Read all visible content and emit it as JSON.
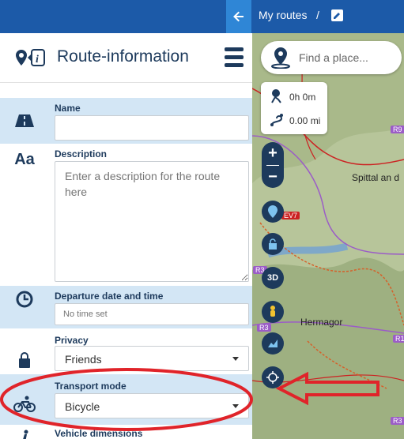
{
  "topbar": {
    "breadcrumb": "My routes",
    "separator": "/"
  },
  "panel": {
    "title": "Route-information",
    "name": {
      "label": "Name",
      "value": ""
    },
    "description": {
      "label": "Description",
      "placeholder": "Enter a description for the route here"
    },
    "departure": {
      "label": "Departure date and time",
      "placeholder": "No time set"
    },
    "privacy": {
      "label": "Privacy",
      "value": "Friends"
    },
    "transport": {
      "label": "Transport mode",
      "value": "Bicycle"
    },
    "vehicle": {
      "label": "Vehicle dimensions"
    }
  },
  "map": {
    "search_placeholder": "Find a place...",
    "duration": "0h 0m",
    "distance": "0.00 mi",
    "zoom_in": "+",
    "zoom_out": "−",
    "btn_3d": "3D",
    "places": [
      "Spittal an d",
      "Hermagor"
    ],
    "road_tags": [
      "R9",
      "EV7",
      "R3",
      "R3",
      "R1",
      "R3"
    ]
  },
  "icons": {
    "back": "arrow-left-icon",
    "edit": "pencil-icon",
    "logo": "route-info-icon",
    "menu": "hamburger-icon",
    "name": "road-icon",
    "description": "text-aa-icon",
    "departure": "clock-icon",
    "privacy": "lock-icon",
    "transport": "bicycle-icon",
    "vehicle": "person-icon"
  },
  "colors": {
    "topbar": "#1c5aa8",
    "panel_text": "#1d3a5c",
    "highlight": "#d3e6f5",
    "annotation": "#e0242a"
  }
}
